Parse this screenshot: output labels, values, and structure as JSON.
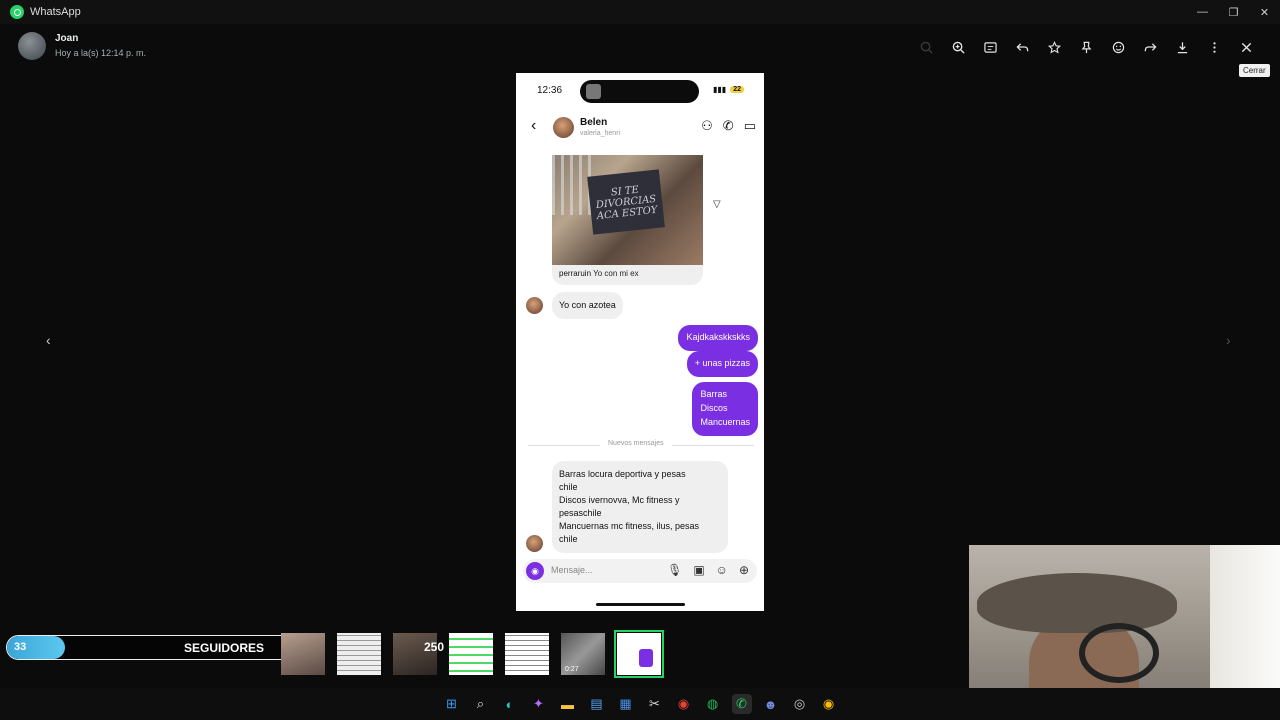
{
  "window": {
    "app_title": "WhatsApp",
    "controls": [
      "—",
      "❐",
      "✕"
    ]
  },
  "viewer": {
    "sender_name": "Joan",
    "sender_time": "Hoy a la(s) 12:14 p. m.",
    "tooltip": "Cerrar",
    "toolbar_icons": [
      "zoom-out-icon",
      "zoom-in-icon",
      "caption-icon",
      "reply-icon",
      "star-icon",
      "pin-icon",
      "emoji-icon",
      "forward-icon",
      "download-icon",
      "more-icon",
      "close-icon"
    ]
  },
  "phone": {
    "status_time": "12:36",
    "battery": "22",
    "contact_name": "Belen",
    "contact_user": "valeria_henri",
    "photo_sign": "SI TE DIVORCIAS ACA ESTOY",
    "caption_user": "perraruin",
    "caption_text": "Yo con mi ex",
    "messages_in_1": "Yo con azotea",
    "messages_out": [
      "Kajdkakskkskks",
      "+ unas pizzas",
      "Barras\nDiscos\nMancuernas"
    ],
    "divider": "Nuevos mensajes",
    "message_in_2_lines": [
      "Barras locura deportiva y pesas",
      "chile",
      "Discos ivernovva, Mc fitness y",
      "pesaschile",
      "Mancuernas mc fitness, ilus, pesas",
      "chile"
    ],
    "composer_placeholder": "Mensaje..."
  },
  "overlay": {
    "followers_current": "33",
    "followers_label": "SEGUIDORES",
    "followers_goal": "250",
    "followers_progress": 0.13,
    "thumb_duration": "0:27"
  },
  "colors": {
    "accent_purple": "#7b2fe3",
    "whatsapp_green": "#25d366",
    "progress_blue": "#3aa6d8"
  }
}
